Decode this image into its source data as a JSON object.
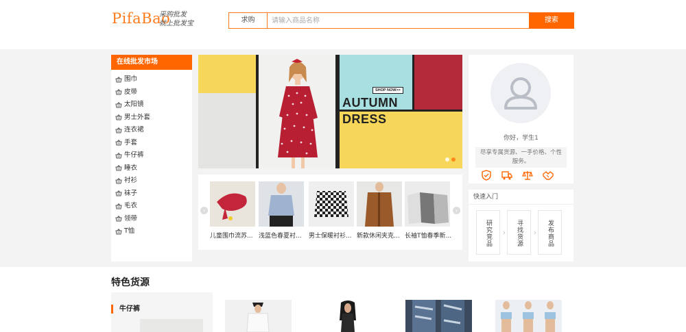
{
  "header": {
    "logo": "PifaBao",
    "slogan_line1": "采购批发",
    "slogan_line2": "就上批发宝",
    "search_type": "求购",
    "search_placeholder": "请输入商品名称",
    "search_button": "搜索"
  },
  "categories": {
    "title": "在线批发市场",
    "icon": "basket-icon",
    "items": [
      "围巾",
      "皮带",
      "太阳镜",
      "男士外套",
      "连衣裙",
      "手套",
      "牛仔裤",
      "睡衣",
      "衬衫",
      "袜子",
      "毛衣",
      "领带",
      "T恤"
    ]
  },
  "banner": {
    "line1": "AUTUMN",
    "line2": "DRESS",
    "cta": "SHOP NOW>>",
    "slides": 2,
    "active_slide": 2
  },
  "carousel": {
    "items": [
      {
        "name": "儿童围巾流苏..."
      },
      {
        "name": "浅蓝色春夏衬..."
      },
      {
        "name": "男士保暖衬衫..."
      },
      {
        "name": "新款休闲夹克..."
      },
      {
        "name": "长袖T恤春季新..."
      }
    ]
  },
  "user": {
    "greeting": "你好，学生1",
    "slogan": "尽享专属货源、一手价格、个性服务。",
    "badges": [
      "shield-check-icon",
      "truck-icon",
      "scale-icon",
      "handshake-icon"
    ]
  },
  "quick": {
    "title": "快速入门",
    "buttons": [
      "研究竞品",
      "寻找货源",
      "发布商品"
    ]
  },
  "featured": {
    "title": "特色货源",
    "tab": "牛仔裤"
  },
  "colors": {
    "accent": "#ff6600",
    "page_bg": "#f3f3f3"
  }
}
